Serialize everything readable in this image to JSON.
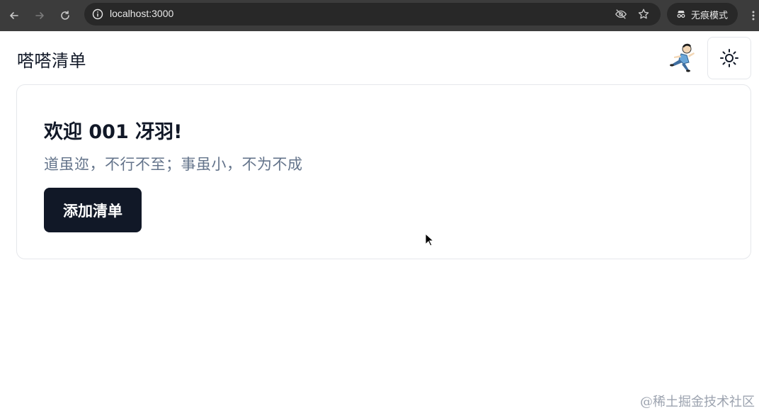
{
  "browser": {
    "url": "localhost:3000",
    "incognito_label": "无痕模式"
  },
  "app": {
    "title": "嗒嗒清单"
  },
  "card": {
    "welcome": "欢迎 001 冴羽!",
    "quote": "道虽迩，不行不至；事虽小，不为不成",
    "add_button": "添加清单"
  },
  "watermark": "@稀土掘金技术社区",
  "colors": {
    "primary": "#111827",
    "muted": "#64748b",
    "border": "#e5e7eb",
    "chrome": "#3c3c3c"
  }
}
